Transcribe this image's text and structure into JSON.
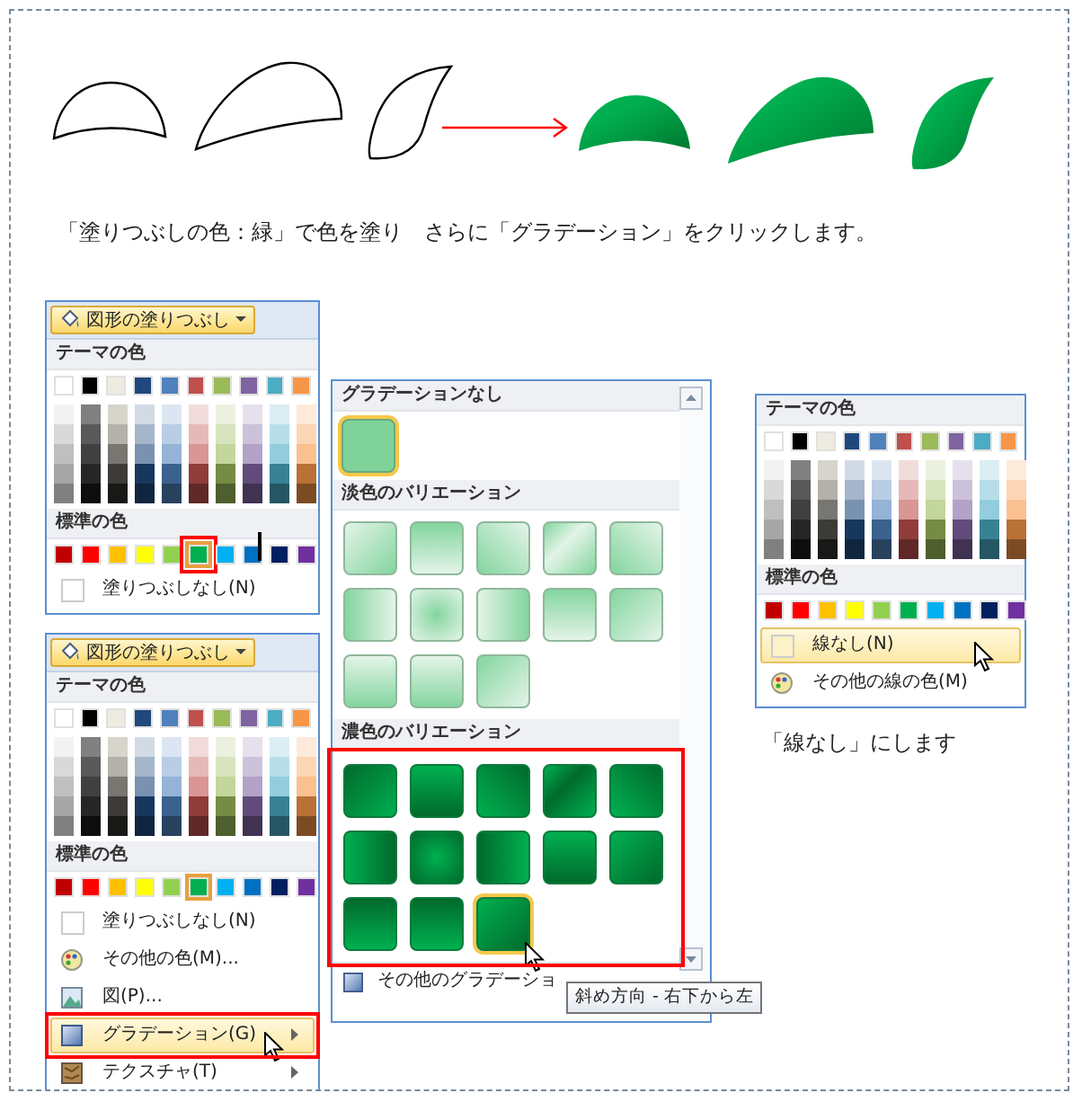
{
  "caption": "「塗りつぶしの色：緑」で色を塗り　さらに「グラデーション」をクリックします。",
  "fill_panels": [
    {
      "button": "図形の塗りつぶし",
      "theme_heading": "テーマの色",
      "standard_heading": "標準の色",
      "text_cursor": true,
      "frame_selected_color": true,
      "theme_colors": [
        {
          "color": "#ffffff"
        },
        {
          "color": "#000000"
        },
        {
          "color": "#eeece1"
        },
        {
          "color": "#1f497d"
        },
        {
          "color": "#4f81bd"
        },
        {
          "color": "#c0504d"
        },
        {
          "color": "#9bbb59"
        },
        {
          "color": "#8064a2"
        },
        {
          "color": "#4bacc6"
        },
        {
          "color": "#f79646"
        }
      ],
      "standard_colors": [
        {
          "color": "#c00000",
          "selected": false
        },
        {
          "color": "#ff0000",
          "selected": false
        },
        {
          "color": "#ffc000",
          "selected": false
        },
        {
          "color": "#ffff00",
          "selected": false
        },
        {
          "color": "#92d050",
          "selected": false
        },
        {
          "color": "#00b050",
          "selected": true
        },
        {
          "color": "#00b0f0",
          "selected": false
        },
        {
          "color": "#0070c0",
          "selected": false
        },
        {
          "color": "#002060",
          "selected": false
        },
        {
          "color": "#7030a0",
          "selected": false
        }
      ],
      "items": [
        {
          "kind": "none",
          "label": "塗りつぶしなし(N)",
          "highlighted": false,
          "submenu": false
        }
      ]
    },
    {
      "button": "図形の塗りつぶし",
      "theme_heading": "テーマの色",
      "standard_heading": "標準の色",
      "frame_highlighted_item": true,
      "theme_colors": [
        {
          "color": "#ffffff"
        },
        {
          "color": "#000000"
        },
        {
          "color": "#eeece1"
        },
        {
          "color": "#1f497d"
        },
        {
          "color": "#4f81bd"
        },
        {
          "color": "#c0504d"
        },
        {
          "color": "#9bbb59"
        },
        {
          "color": "#8064a2"
        },
        {
          "color": "#4bacc6"
        },
        {
          "color": "#f79646"
        }
      ],
      "standard_colors": [
        {
          "color": "#c00000",
          "selected": false
        },
        {
          "color": "#ff0000",
          "selected": false
        },
        {
          "color": "#ffc000",
          "selected": false
        },
        {
          "color": "#ffff00",
          "selected": false
        },
        {
          "color": "#92d050",
          "selected": false
        },
        {
          "color": "#00b050",
          "selected": true
        },
        {
          "color": "#00b0f0",
          "selected": false
        },
        {
          "color": "#0070c0",
          "selected": false
        },
        {
          "color": "#002060",
          "selected": false
        },
        {
          "color": "#7030a0",
          "selected": false
        }
      ],
      "items": [
        {
          "kind": "none",
          "label": "塗りつぶしなし(N)",
          "highlighted": false,
          "submenu": false
        },
        {
          "kind": "more_colors",
          "label": "その他の色(M)...",
          "highlighted": false,
          "submenu": false
        },
        {
          "kind": "picture",
          "label": "図(P)...",
          "highlighted": false,
          "submenu": false
        },
        {
          "kind": "gradient",
          "label": "グラデーション(G)",
          "highlighted": true,
          "submenu": true
        },
        {
          "kind": "texture",
          "label": "テクスチャ(T)",
          "highlighted": false,
          "submenu": true
        }
      ]
    }
  ],
  "gradient_panel": {
    "none_heading": "グラデーションなし",
    "none_swatch": {
      "selected": true
    },
    "light_heading": "淡色のバリエーション",
    "light_swatches": [
      {
        "hovered": false
      },
      {
        "hovered": false
      },
      {
        "hovered": false
      },
      {
        "hovered": false
      },
      {
        "hovered": false
      },
      {
        "hovered": false
      },
      {
        "hovered": false
      },
      {
        "hovered": false
      },
      {
        "hovered": false
      },
      {
        "hovered": false
      },
      {
        "hovered": false
      },
      {
        "hovered": false
      },
      {
        "hovered": false
      }
    ],
    "dark_heading": "濃色のバリエーション",
    "dark_marked": true,
    "dark_swatches": [
      {
        "hovered": false
      },
      {
        "hovered": false
      },
      {
        "hovered": false
      },
      {
        "hovered": false
      },
      {
        "hovered": false
      },
      {
        "hovered": false
      },
      {
        "hovered": false
      },
      {
        "hovered": false
      },
      {
        "hovered": false
      },
      {
        "hovered": false
      },
      {
        "hovered": false
      },
      {
        "hovered": false
      },
      {
        "hovered": true
      }
    ],
    "more_item": "その他のグラデーショ",
    "tooltip": "斜め方向 - 右下から左"
  },
  "line_panel": {
    "theme_heading": "テーマの色",
    "standard_heading": "標準の色",
    "theme_colors": [
      {
        "color": "#ffffff"
      },
      {
        "color": "#000000"
      },
      {
        "color": "#eeece1"
      },
      {
        "color": "#1f497d"
      },
      {
        "color": "#4f81bd"
      },
      {
        "color": "#c0504d"
      },
      {
        "color": "#9bbb59"
      },
      {
        "color": "#8064a2"
      },
      {
        "color": "#4bacc6"
      },
      {
        "color": "#f79646"
      }
    ],
    "standard_colors": [
      {
        "color": "#c00000",
        "selected": false
      },
      {
        "color": "#ff0000",
        "selected": false
      },
      {
        "color": "#ffc000",
        "selected": false
      },
      {
        "color": "#ffff00",
        "selected": false
      },
      {
        "color": "#92d050",
        "selected": false
      },
      {
        "color": "#00b050",
        "selected": false
      },
      {
        "color": "#00b0f0",
        "selected": false
      },
      {
        "color": "#0070c0",
        "selected": false
      },
      {
        "color": "#002060",
        "selected": false
      },
      {
        "color": "#7030a0",
        "selected": false
      }
    ],
    "items": [
      {
        "kind": "none",
        "label": "線なし(N)",
        "highlighted": true,
        "submenu": false
      },
      {
        "kind": "more_colors",
        "label": "その他の線の色(M)",
        "highlighted": false,
        "submenu": false
      }
    ]
  },
  "line_note": "「線なし」にします"
}
